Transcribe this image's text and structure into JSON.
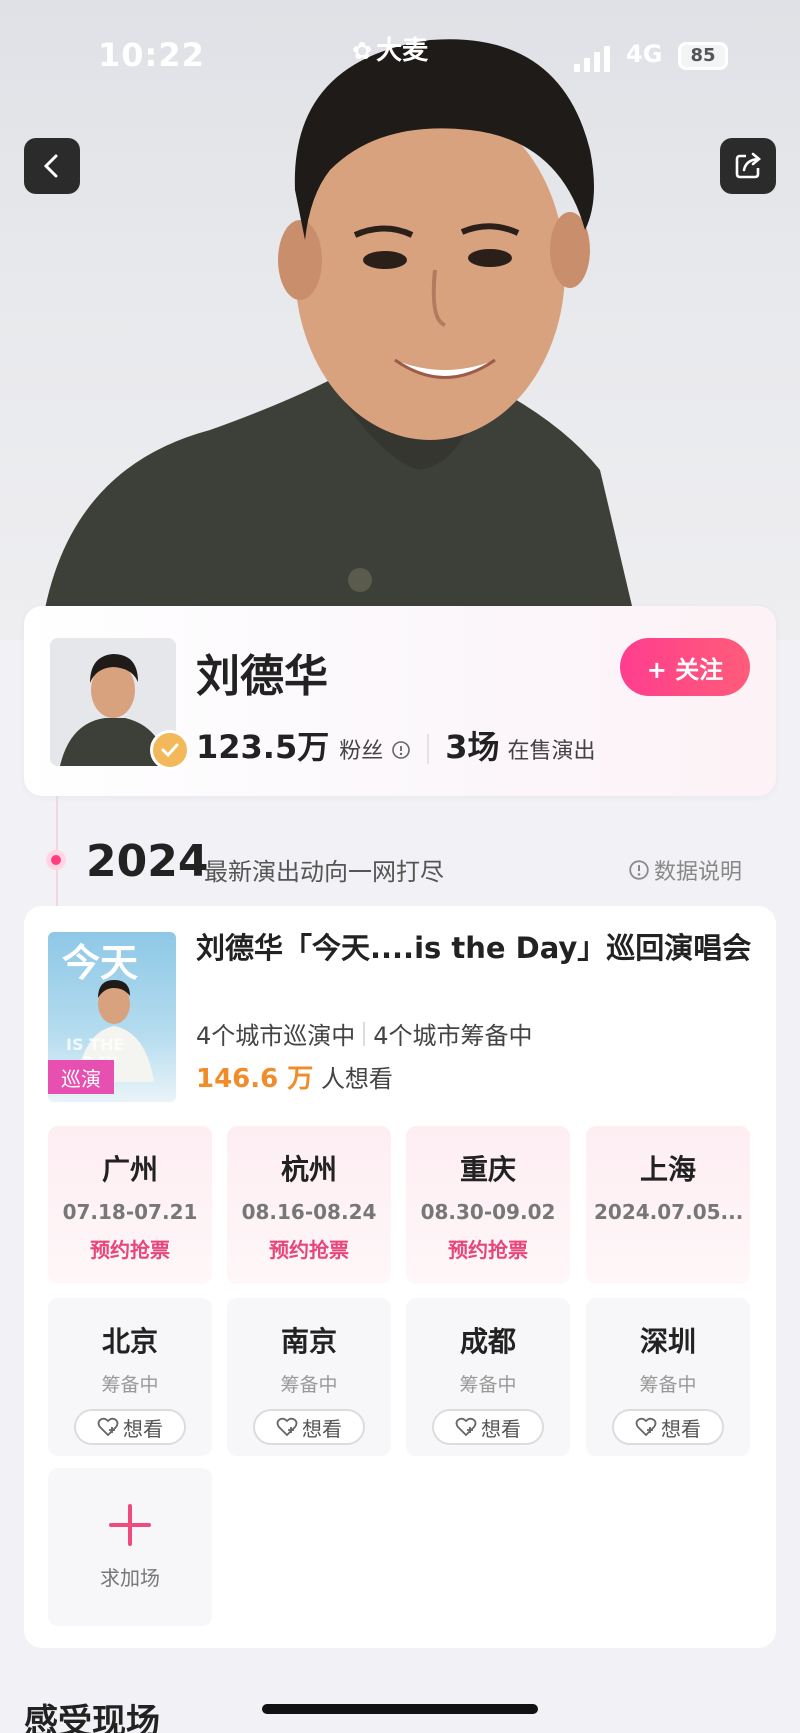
{
  "status_bar": {
    "time": "10:22",
    "app_name": "大麦",
    "network": "4G",
    "battery": "85"
  },
  "artist": {
    "name": "刘德华",
    "follow_label": "+ 关注",
    "fans_count": "123.5万",
    "fans_label": "粉丝",
    "shows_count": "3场",
    "shows_label": "在售演出"
  },
  "timeline": {
    "year": "2024",
    "subtitle": "最新演出动向一网打尽",
    "data_note": "数据说明"
  },
  "event": {
    "title": "刘德华「今天....is the Day」巡回演唱会",
    "tour_badge": "巡演",
    "cities_touring": "4个城市巡演中",
    "cities_preparing": "4个城市筹备中",
    "want_count": "146.6 万",
    "want_label": "人想看",
    "active_cities": [
      {
        "name": "广州",
        "date": "07.18-07.21",
        "action": "预约抢票"
      },
      {
        "name": "杭州",
        "date": "08.16-08.24",
        "action": "预约抢票"
      },
      {
        "name": "重庆",
        "date": "08.30-09.02",
        "action": "预约抢票"
      },
      {
        "name": "上海",
        "date": "2024.07.05...",
        "action": ""
      }
    ],
    "planned_cities": [
      {
        "name": "北京",
        "status": "筹备中",
        "want": "想看"
      },
      {
        "name": "南京",
        "status": "筹备中",
        "want": "想看"
      },
      {
        "name": "成都",
        "status": "筹备中",
        "want": "想看"
      },
      {
        "name": "深圳",
        "status": "筹备中",
        "want": "想看"
      }
    ],
    "add_label": "求加场"
  },
  "next_section": "感受现场",
  "colors": {
    "accent_pink": "#ff3d8f",
    "want_orange": "#f08c2a",
    "badge_gold": "#f3b85a"
  }
}
